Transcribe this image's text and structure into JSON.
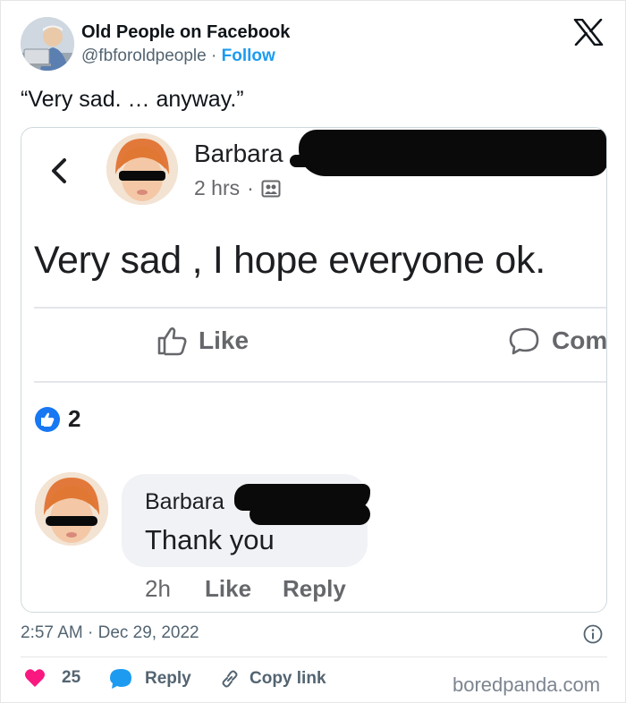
{
  "tweet": {
    "author_name": "Old People on Facebook",
    "handle": "@fbforoldpeople",
    "separator": "·",
    "follow_label": "Follow",
    "text": "“Very sad. … anyway.”",
    "time": "2:57 AM · Dec 29, 2022"
  },
  "embedded_post": {
    "poster_name": "Barbara",
    "meta_time": "2 hrs",
    "meta_separator": "·",
    "post_text": "Very sad , I hope  everyone ok.",
    "like_label": "Like",
    "comment_label": "Com",
    "reaction_count": "2",
    "comment": {
      "name": "Barbara",
      "text": "Thank you",
      "time": "2h",
      "like_label": "Like",
      "reply_label": "Reply"
    }
  },
  "engagement": {
    "like_count": "25",
    "reply_label": "Reply",
    "copy_link_label": "Copy link"
  },
  "watermark": "boredpanda.com",
  "colors": {
    "twitter_blue": "#1d9bf0",
    "heart_pink": "#f91880",
    "fb_blue": "#1877f2",
    "text_secondary": "#536471"
  }
}
